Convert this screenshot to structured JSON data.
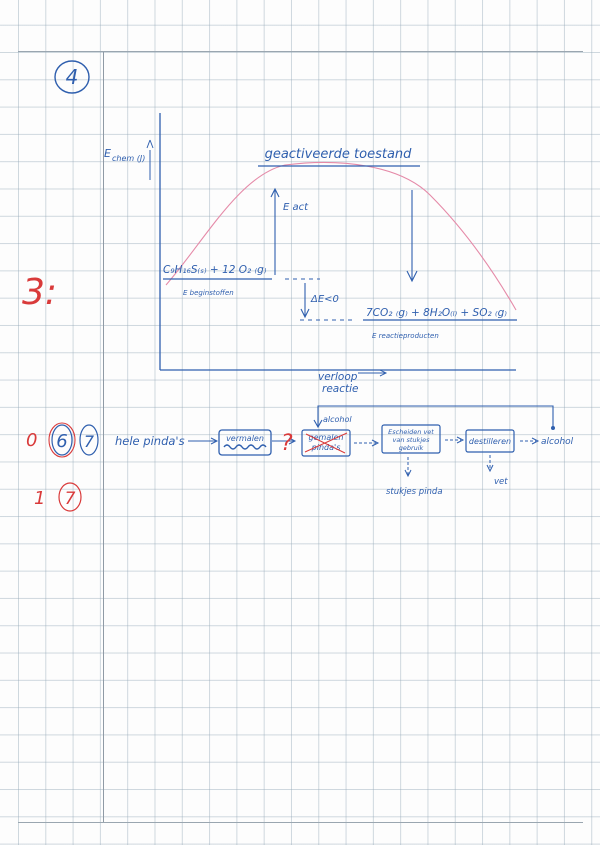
{
  "colors": {
    "ink_blue": "#2f5fae",
    "ink_red": "#d93a3a",
    "curve_pink": "#e58aa8",
    "grid": "#a8b6c2"
  },
  "margin": {
    "q4_number": "4",
    "q4_score": "3:",
    "q6_score_left": "0",
    "q6_number": "6",
    "q7_number_blue": "7",
    "q7_score_left": "1",
    "q7_number_red": "7"
  },
  "energy_diagram": {
    "y_axis_label": "E",
    "y_axis_sub": "chem (J)",
    "activated_state": "geactiveerde toestand",
    "e_act": "E act",
    "reactants": "C₉H₁₆S₍ₛ₎ + 12 O₂ ₍g₎",
    "e_begin": "E beginstoffen",
    "delta_e": "ΔE<0",
    "products": "7CO₂ ₍g₎ + 8H₂O₍ₗ₎ + SO₂ ₍g₎",
    "e_products": "E reactieproducten",
    "x_axis_label_1": "verloop",
    "x_axis_label_2": "reactie"
  },
  "process_diagram": {
    "start": "hele pinda's",
    "box1": "vermalen",
    "question_mark": "?",
    "box2_line1": "gemalen",
    "box2_line2": "pinda's",
    "box3_line1": "Escheiden vet",
    "box3_line2": "van stukjes",
    "box3_line3": "gebruik",
    "box4": "destilleren",
    "end": "alcohol",
    "recycle": "alcohol",
    "output1": "stukjes pinda",
    "output2": "vet"
  }
}
